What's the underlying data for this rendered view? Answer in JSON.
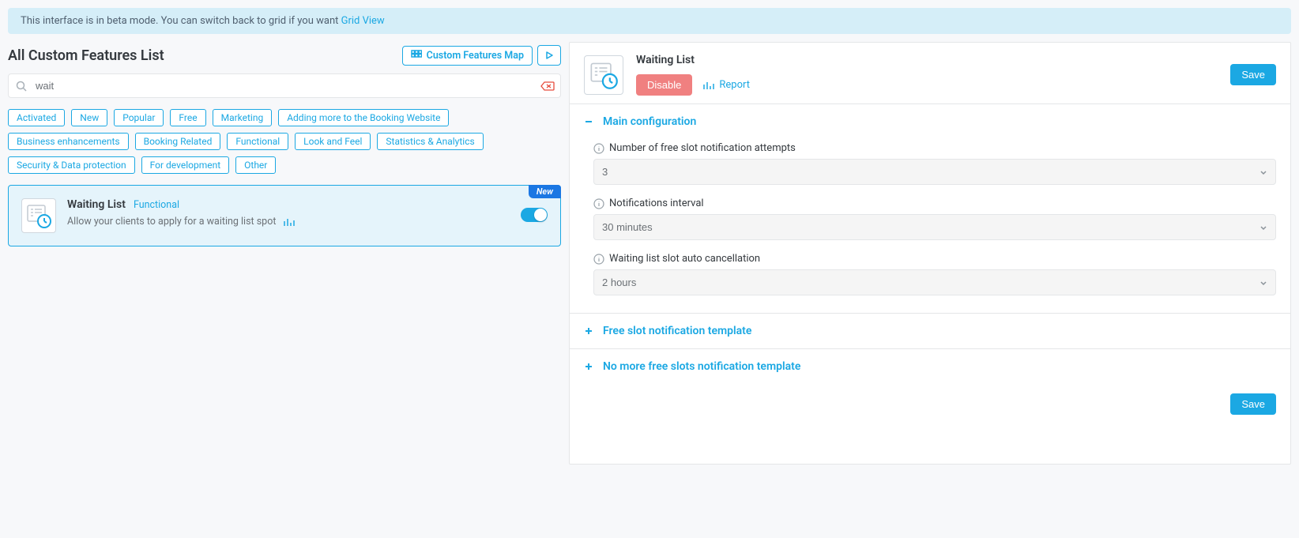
{
  "banner": {
    "text": "This interface is in beta mode. You can switch back to grid if you want ",
    "link": "Grid View"
  },
  "list": {
    "title": "All Custom Features List",
    "map_link": "Custom Features Map",
    "search_value": "wait",
    "chips": [
      "Activated",
      "New",
      "Popular",
      "Free",
      "Marketing",
      "Adding more to the Booking Website",
      "Business enhancements",
      "Booking Related",
      "Functional",
      "Look and Feel",
      "Statistics & Analytics",
      "Security & Data protection",
      "For development",
      "Other"
    ]
  },
  "feature": {
    "badge": "New",
    "title": "Waiting List",
    "tag": "Functional",
    "desc": "Allow your clients to apply for a waiting list spot"
  },
  "panel": {
    "title": "Waiting List",
    "disable_label": "Disable",
    "report_label": "Report",
    "save_label": "Save",
    "sections": {
      "main": {
        "title": "Main configuration",
        "fields": {
          "attempts": {
            "label": "Number of free slot notification attempts",
            "value": "3"
          },
          "interval": {
            "label": "Notifications interval",
            "value": "30 minutes"
          },
          "cancellation": {
            "label": "Waiting list slot auto cancellation",
            "value": "2 hours"
          }
        }
      },
      "free_slot": {
        "title": "Free slot notification template"
      },
      "no_more": {
        "title": "No more free slots notification template"
      }
    }
  }
}
